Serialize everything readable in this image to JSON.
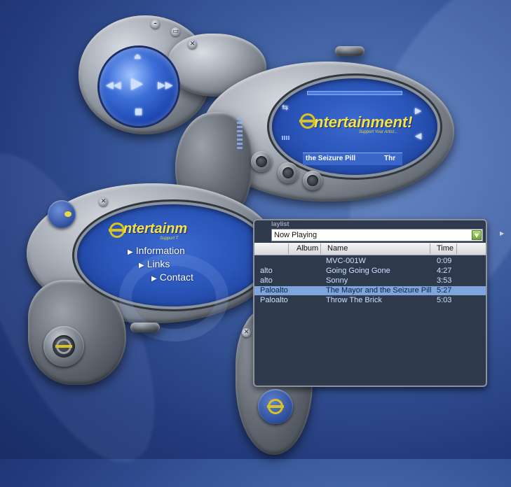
{
  "player": {
    "brand": "ntertainment!",
    "tagline": "Support Your Artist...",
    "now_playing_scroll": "the Seizure Pill",
    "now_playing_scroll_tail": "Thr"
  },
  "menu_panel": {
    "brand": "ntertainm",
    "tagline": "Support T",
    "items": [
      {
        "label": "Information"
      },
      {
        "label": "Links"
      },
      {
        "label": "Contact"
      }
    ]
  },
  "playlist": {
    "title": "laylist",
    "selected_list": "Now Playing",
    "columns": [
      "Album",
      "Name",
      "Time"
    ],
    "rows": [
      {
        "artist": "",
        "name": "MVC-001W",
        "time": "0:09"
      },
      {
        "artist": "alto",
        "name": "Going Going Gone",
        "time": "4:27"
      },
      {
        "artist": "alto",
        "name": "Sonny",
        "time": "3:53"
      },
      {
        "artist": "Paloalto",
        "name": "The Mayor and the Seizure Pill",
        "time": "5:27",
        "selected": true
      },
      {
        "artist": "Paloalto",
        "name": "Throw The Brick",
        "time": "5:03"
      }
    ]
  },
  "window_buttons": {
    "minimize": "–",
    "restore": "▭",
    "close": "✕"
  },
  "colors": {
    "accent_yellow": "#f3e24a",
    "selection": "#7ea6dc",
    "background": "#2a4686"
  }
}
